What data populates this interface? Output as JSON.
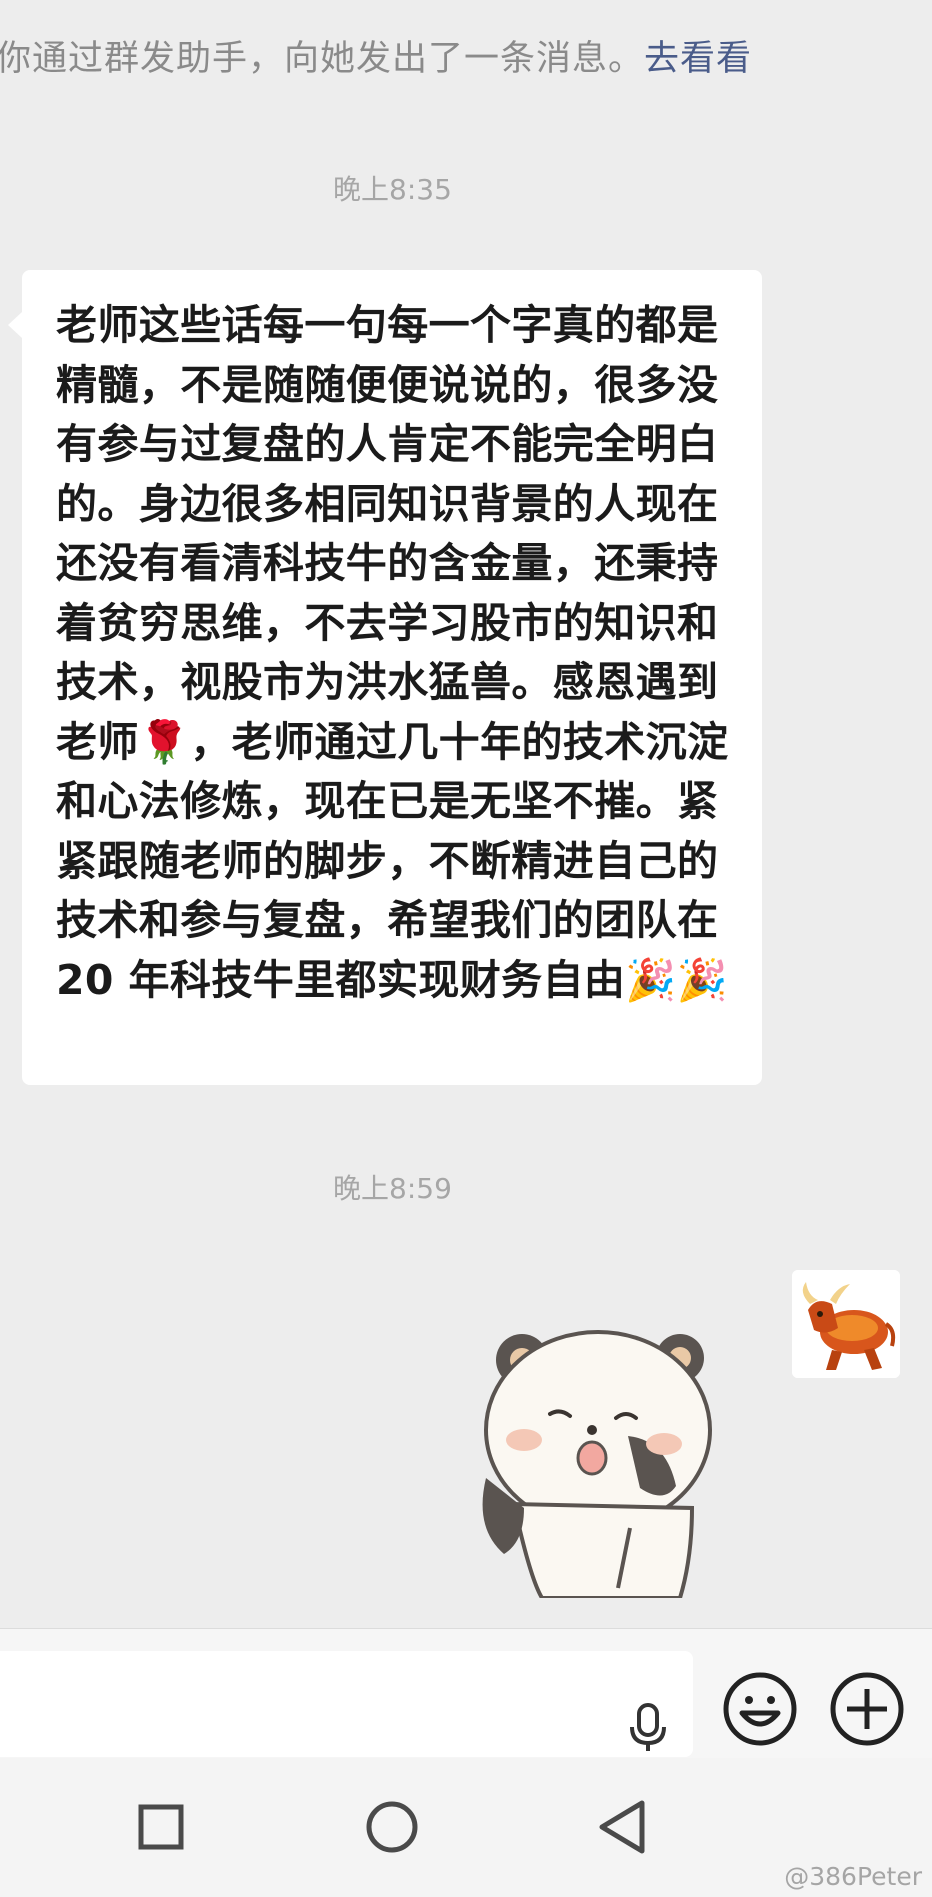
{
  "system_notice": {
    "text": "你通过群发助手，向她发出了一条消息。",
    "link": "去看看"
  },
  "timestamps": [
    "晚上8:35",
    "晚上8:59"
  ],
  "incoming_message": {
    "part1": "老师这些话每一句每一个字真的都是精髓，不是随随便便说说的，很多没有参与过复盘的人肯定不能完全明白的。身边很多相同知识背景的人现在还没有看清科技牛的含金量，还秉持着贫穷思维，不去学习股市的知识和技术，视股市为洪水猛兽。感恩遇到老师",
    "emoji1": "🌹",
    "part2": "，老师通过几十年的技术沉淀和心法修炼，现在已是无坚不摧。紧紧跟随老师的脚步，不断精进自己的技术和参与复盘，希望我们的团队在 20 年科技牛里都实现财务自由",
    "emoji2": "🎉🎉"
  },
  "watermark": "@386Peter",
  "icons": {
    "voice": "microphone-icon",
    "emoji": "smiley-icon",
    "more": "plus-circle-icon",
    "nav_recent": "square-icon",
    "nav_home": "circle-icon",
    "nav_back": "triangle-back-icon"
  }
}
